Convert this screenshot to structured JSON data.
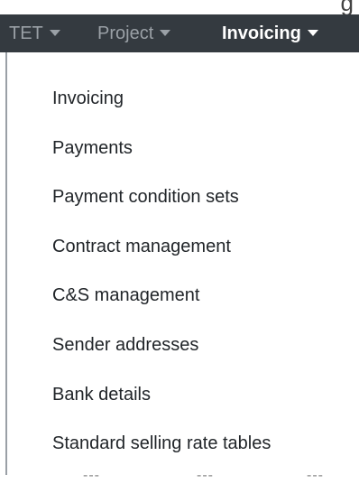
{
  "navbar": {
    "items": [
      {
        "label": "TET",
        "active": false
      },
      {
        "label": "Project",
        "active": false
      },
      {
        "label": "Invoicing",
        "active": true
      }
    ]
  },
  "dropdown": {
    "items": [
      {
        "label": "Invoicing"
      },
      {
        "label": "Payments"
      },
      {
        "label": "Payment condition sets"
      },
      {
        "label": "Contract management"
      },
      {
        "label": "C&S management"
      },
      {
        "label": "Sender addresses"
      },
      {
        "label": "Bank details"
      },
      {
        "label": "Standard selling rate tables"
      }
    ]
  },
  "colors": {
    "navbar_bg": "#343a40",
    "inactive_text": "#9aa0a6",
    "active_text": "#ffffff",
    "menu_text": "#212529"
  }
}
